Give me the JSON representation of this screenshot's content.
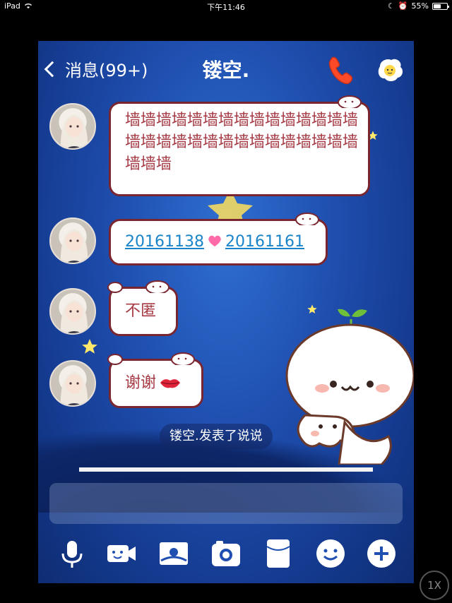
{
  "status_bar": {
    "device": "iPad",
    "time": "下午11:46",
    "battery": "55%",
    "battery_level": 0.55
  },
  "nav": {
    "back_label": "消息(99+)",
    "title": "镂空."
  },
  "messages": [
    {
      "text": "墙墙墙墙墙墙墙墙墙墙墙墙墙墙墙墙墙墙墙墙墙墙墙墙墙墙墙墙墙墙墙墙墙"
    },
    {
      "left": "20161138",
      "right": "20161161"
    },
    {
      "text": "不匿"
    },
    {
      "text": "谢谢"
    }
  ],
  "notice": "镂空.发表了说说",
  "toolbar": {
    "items": [
      "microphone-icon",
      "video-icon",
      "image-icon",
      "camera-icon",
      "redpacket-icon",
      "emoji-icon",
      "plus-icon"
    ]
  },
  "zoom": "1X",
  "colors": {
    "bubble_border": "#7a2630",
    "bubble_text": "#a63a44",
    "link": "#1a84c8",
    "background": "#1f4fb0"
  }
}
